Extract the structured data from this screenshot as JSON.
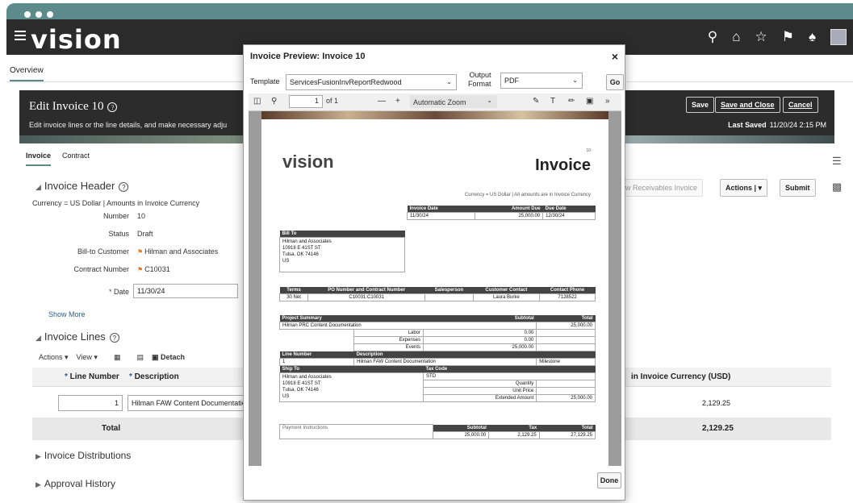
{
  "app": {
    "logo": "vision"
  },
  "nav": {
    "overview": "Overview"
  },
  "edit": {
    "title": "Edit Invoice 10",
    "subtitle": "Edit invoice lines or the line details, and make necessary adju",
    "save": "Save",
    "save_close": "Save and Close",
    "cancel": "Cancel",
    "last_saved_label": "Last Saved",
    "last_saved_value": "11/20/24 2:15 PM"
  },
  "tabs": [
    "Invoice",
    "Contract"
  ],
  "header": {
    "title": "Invoice Header",
    "currency": "Currency = US Dollar | Amounts in Invoice Currency",
    "number_label": "Number",
    "number": "10",
    "status_label": "Status",
    "status": "Draft",
    "bill_label": "Bill-to Customer",
    "bill": "Hilman and Associates",
    "contract_label": "Contract Number",
    "contract": "C10031",
    "date_label": "Date",
    "date": "11/30/24",
    "show_more": "Show More"
  },
  "lines": {
    "title": "Invoice Lines",
    "actions": "Actions",
    "view": "View",
    "detach": "Detach",
    "col_line": "Line Number",
    "col_desc": "Description",
    "col_amount": "in Invoice Currency (USD)",
    "row_line": "1",
    "row_desc": "Hilman FAW Content Documentation",
    "row_amount": "2,129.25",
    "total_label": "Total",
    "total_amount": "2,129.25"
  },
  "sections": {
    "distributions": "Invoice Distributions",
    "approval": "Approval History"
  },
  "right_buttons": {
    "receivables": "w Receivables Invoice",
    "actions": "Actions",
    "submit": "Submit"
  },
  "modal": {
    "title": "Invoice Preview: Invoice 10",
    "close": "×",
    "template_label": "Template",
    "template_value": "ServicesFusionInvReportRedwood",
    "output_label_1": "Output",
    "output_label_2": "Format",
    "output_value": "PDF",
    "go": "Go",
    "page_num": "1",
    "page_of": "of 1",
    "zoom": "Automatic Zoom",
    "done": "Done"
  },
  "preview": {
    "logo": "vision",
    "title": "Invoice",
    "number": "10",
    "currency": "Currency = US Dollar | All amounts are in Invoice Currency",
    "inv_date_h": "Invoice Date",
    "amount_due_h": "Amount Due",
    "due_date_h": "Due Date",
    "inv_date": "11/30/24",
    "amount_due": "25,000.00",
    "due_date": "12/30/24",
    "bill_to_h": "Bill To",
    "bill_to": [
      "Hilman and Associates",
      "10918 E 41ST ST",
      "Tulsa, OK 74146",
      "US"
    ],
    "terms_h": "Terms",
    "po_h": "PO Number and Contract Number",
    "sales_h": "Salesperson",
    "contact_h": "Customer Contact",
    "phone_h": "Contact Phone",
    "terms": "30 Net",
    "po": "C10031:C10031",
    "sales": "",
    "contact": "Laura Burke",
    "phone": "7128522",
    "ps_h": "Project Summary",
    "subtotal_h": "Subtotal",
    "total_h": "Total",
    "ps_name": "Hilman PRC Content Documentation",
    "ps_total": "25,000.00",
    "labor": "Labor",
    "labor_v": "0.00",
    "expenses": "Expenses",
    "expenses_v": "0.00",
    "events": "Events",
    "events_v": "25,000.00",
    "ln_h": "Line Number",
    "desc_h": "Description",
    "ln": "1",
    "desc": "Hilman FAW Content Documentation",
    "milestone": "Milestone",
    "ship_h": "Ship To",
    "tax_h": "Tax Code",
    "ship_to": [
      "Hilman and Associates",
      "10918 E 41ST ST",
      "Tulsa, OK 74146",
      "US"
    ],
    "tax_code": "STD",
    "quantity": "Quantity",
    "unit_price": "Unit Price",
    "ext_amount": "Extended Amount",
    "ext_amount_v": "25,000.00",
    "pay_h": "Payment Instructions",
    "tax_col": "Tax",
    "f_subtotal": "25,000.00",
    "f_tax": "2,129.25",
    "f_total": "27,129.25"
  }
}
